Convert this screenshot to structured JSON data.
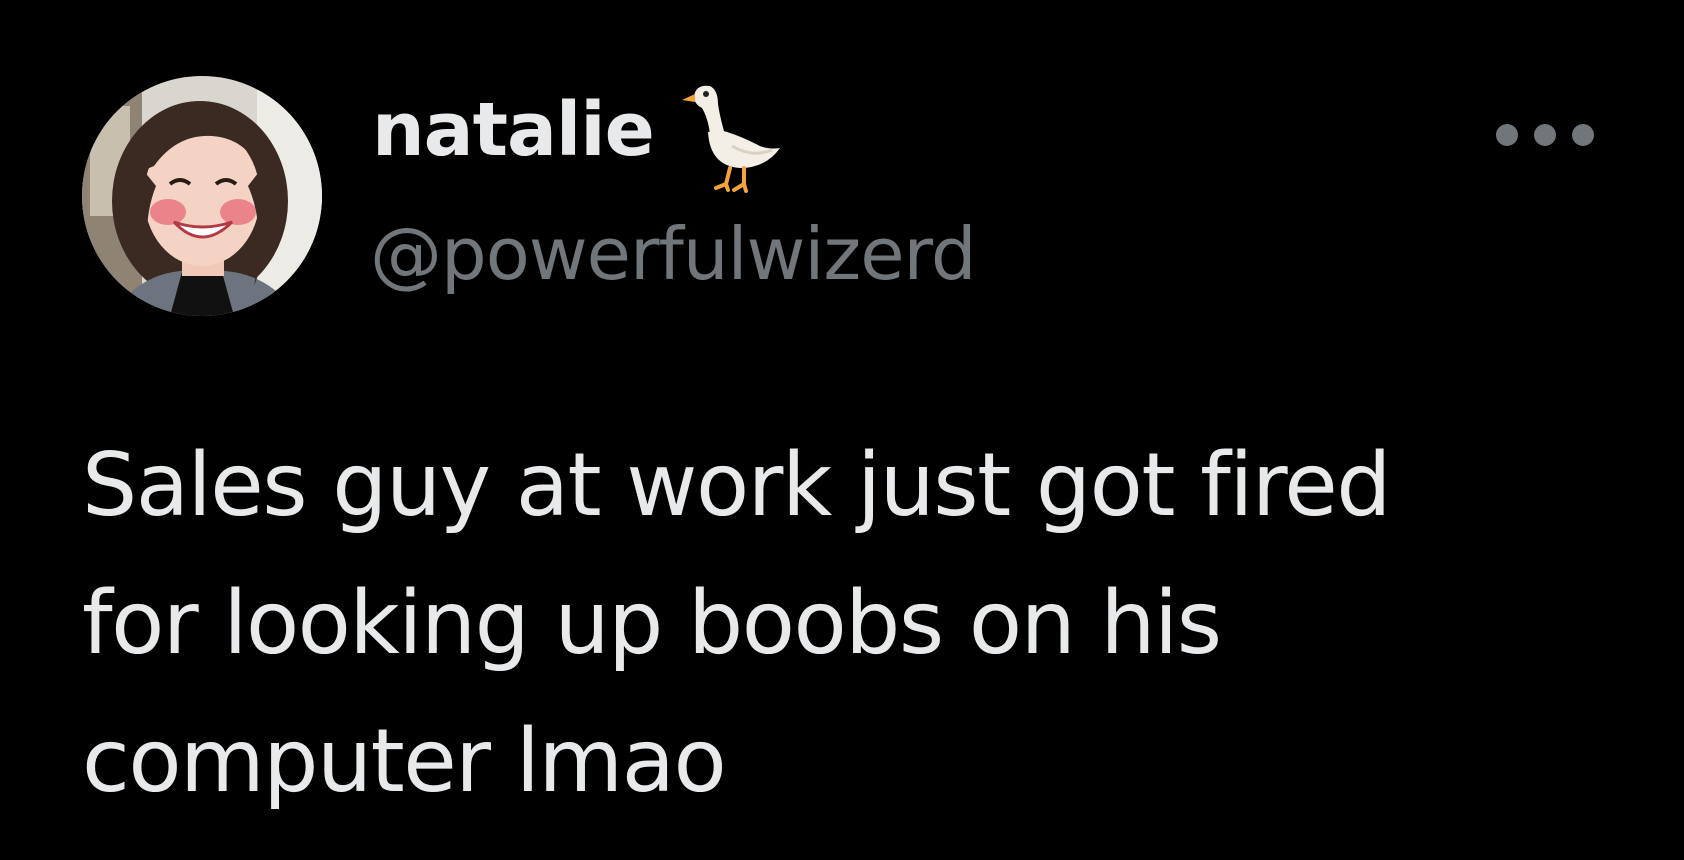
{
  "author": {
    "display_name": "natalie",
    "name_emoji": "goose-icon",
    "handle": "@powerfulwizerd",
    "avatar": "profile-photo"
  },
  "tweet": {
    "text_lines": [
      "Sales guy at work just got fired",
      "for looking up boobs on his",
      "computer lmao"
    ]
  },
  "menu": {
    "icon": "more-options-icon"
  },
  "colors": {
    "background": "#000000",
    "primary_text": "#e7e9ea",
    "secondary_text": "#71767b"
  }
}
